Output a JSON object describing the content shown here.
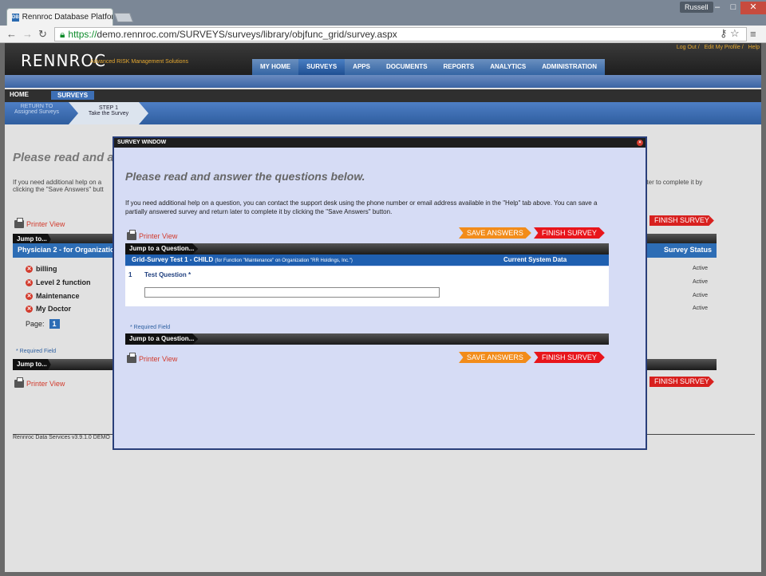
{
  "browser": {
    "tab_title": "Rennroc Database Platfor",
    "favicon_text": "DB",
    "user": "Russell",
    "url_scheme": "https://",
    "url_rest": "demo.rennroc.com/SURVEYS/surveys/library/objfunc_grid/survey.aspx"
  },
  "header": {
    "logo": "RENNROC",
    "tagline": "Advanced RISK Management Solutions",
    "links": [
      "Log Out",
      "Edit My Profile",
      "Help"
    ],
    "nav": [
      "MY HOME",
      "SURVEYS",
      "APPS",
      "DOCUMENTS",
      "REPORTS",
      "ANALYTICS",
      "ADMINISTRATION"
    ],
    "active_nav": "SURVEYS"
  },
  "breadcrumb": {
    "home": "HOME",
    "surveys": "SURVEYS",
    "return_line1": "RETURN TO",
    "return_line2": "Assigned Surveys",
    "step_line1": "STEP 1",
    "step_line2": "Take the Survey"
  },
  "background": {
    "title": "Please read and an",
    "help_left_1": "If you need additional help on a",
    "help_left_2": "clicking the \"Save Answers\" butt",
    "help_right": "ater to complete it by",
    "printer": "Printer View",
    "jump": "Jump to...",
    "section": "Physician 2 - for Organizatio",
    "status_head": "Survey Status",
    "items": [
      {
        "label": "billing",
        "status": "Active"
      },
      {
        "label": "Level 2 function",
        "status": "Active"
      },
      {
        "label": "Maintenance",
        "status": "Active"
      },
      {
        "label": "My Doctor",
        "status": "Active"
      }
    ],
    "page_label": "Page:",
    "page_num": "1",
    "required": "* Required Field",
    "finish": "FINISH SURVEY",
    "footer": "Rennroc Data Services v3.9.1.0 DEMO"
  },
  "modal": {
    "title_bar": "SURVEY WINDOW",
    "close": "×",
    "title": "Please read and answer the questions below.",
    "help": "If you need additional help on a question, you can contact the support desk using the phone number or email address available in the \"Help\" tab above. You can save a partially answered survey and return later to complete it by clicking the \"Save Answers\" button.",
    "printer": "Printer View",
    "save": "SAVE ANSWERS",
    "finish": "FINISH SURVEY",
    "jump": "Jump to a Question...",
    "section_title": "Grid-Survey Test 1 - CHILD",
    "section_sub": "(for Function \"Maintenance\" on Organization \"RR Holdings, Inc.\")",
    "section_right": "Current System Data",
    "question_num": "1",
    "question_label": "Test Question *",
    "required": "* Required Field"
  }
}
